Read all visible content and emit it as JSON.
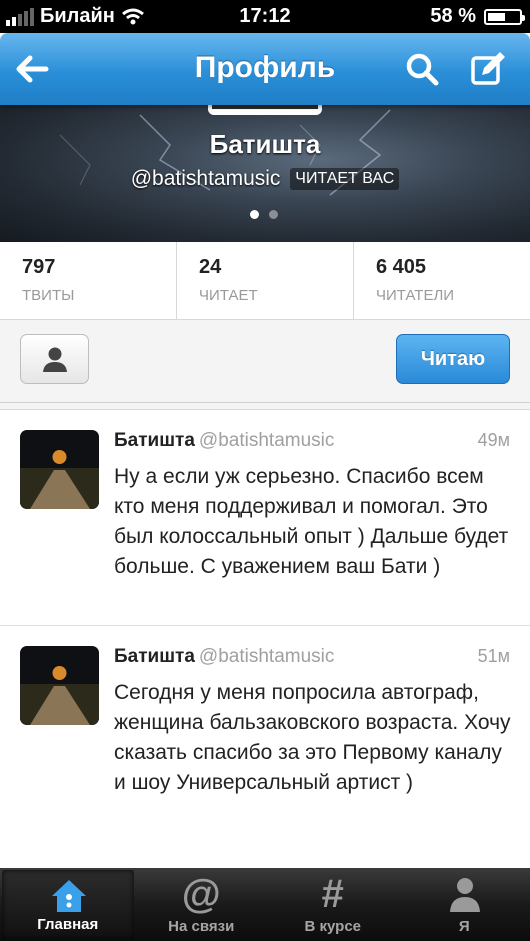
{
  "status_bar": {
    "carrier": "Билайн",
    "time": "17:12",
    "battery": "58 %",
    "battery_level": 0.58
  },
  "nav": {
    "title": "Профиль"
  },
  "profile": {
    "name": "Батишта",
    "handle": "@batishtamusic",
    "follows_you": "ЧИТАЕТ ВАС",
    "page_dots": 2,
    "active_dot": 0
  },
  "stats": [
    {
      "value": "797",
      "label": "ТВИТЫ"
    },
    {
      "value": "24",
      "label": "ЧИТАЕТ"
    },
    {
      "value": "6 405",
      "label": "ЧИТАТЕЛИ"
    }
  ],
  "actions": {
    "follow_label": "Читаю"
  },
  "tweets": [
    {
      "author": "Батишта",
      "username": "@batishtamusic",
      "time": "49м",
      "text": "Ну а если уж серьезно. Спасибо всем кто меня поддерживал и помогал. Это был колоссальный опыт ) Дальше будет больше. С уважением ваш Бати )"
    },
    {
      "author": "Батишта",
      "username": "@batishtamusic",
      "time": "51м",
      "text": "Сегодня у меня попросила автограф, женщина бальзаковского возраста. Хочу сказать спасибо за это Первому каналу и шоу Универсальный артист )"
    }
  ],
  "tabbar": {
    "items": [
      {
        "label": "Главная",
        "icon": "home-icon",
        "active": true
      },
      {
        "label": "На связи",
        "icon": "at-icon",
        "active": false
      },
      {
        "label": "В курсе",
        "icon": "hash-icon",
        "active": false
      },
      {
        "label": "Я",
        "icon": "person-icon",
        "active": false
      }
    ]
  },
  "colors": {
    "accent": "#2a8fd8",
    "follow_button": "#3d9de3"
  }
}
